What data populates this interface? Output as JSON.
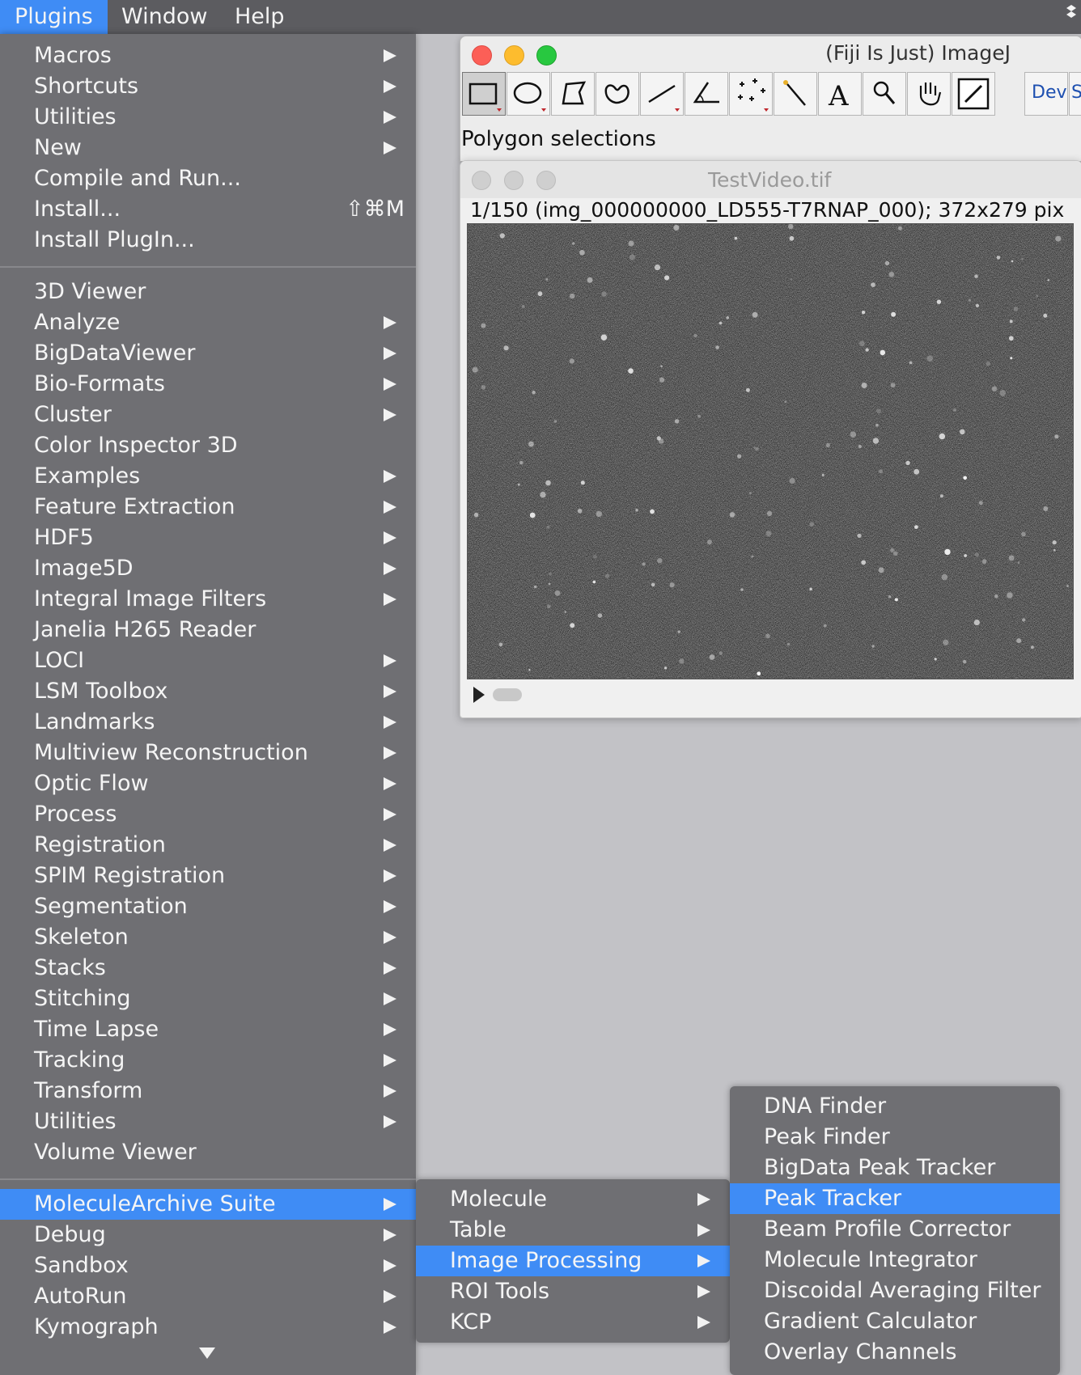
{
  "menubar": {
    "items": [
      "Plugins",
      "Window",
      "Help"
    ]
  },
  "plugins_menu": {
    "group1": [
      {
        "label": "Macros",
        "arrow": true
      },
      {
        "label": "Shortcuts",
        "arrow": true
      },
      {
        "label": "Utilities",
        "arrow": true
      },
      {
        "label": "New",
        "arrow": true
      },
      {
        "label": "Compile and Run...",
        "arrow": false
      },
      {
        "label": "Install...",
        "arrow": false,
        "shortcut": "⇧⌘M"
      },
      {
        "label": "Install PlugIn...",
        "arrow": false
      }
    ],
    "group2": [
      {
        "label": "3D Viewer",
        "arrow": false
      },
      {
        "label": "Analyze",
        "arrow": true
      },
      {
        "label": "BigDataViewer",
        "arrow": true
      },
      {
        "label": "Bio-Formats",
        "arrow": true
      },
      {
        "label": "Cluster",
        "arrow": true
      },
      {
        "label": "Color Inspector 3D",
        "arrow": false
      },
      {
        "label": "Examples",
        "arrow": true
      },
      {
        "label": "Feature Extraction",
        "arrow": true
      },
      {
        "label": "HDF5",
        "arrow": true
      },
      {
        "label": "Image5D",
        "arrow": true
      },
      {
        "label": "Integral Image Filters",
        "arrow": true
      },
      {
        "label": "Janelia H265 Reader",
        "arrow": false
      },
      {
        "label": "LOCI",
        "arrow": true
      },
      {
        "label": "LSM Toolbox",
        "arrow": true
      },
      {
        "label": "Landmarks",
        "arrow": true
      },
      {
        "label": "Multiview Reconstruction",
        "arrow": true
      },
      {
        "label": "Optic Flow",
        "arrow": true
      },
      {
        "label": "Process",
        "arrow": true
      },
      {
        "label": "Registration",
        "arrow": true
      },
      {
        "label": "SPIM Registration",
        "arrow": true
      },
      {
        "label": "Segmentation",
        "arrow": true
      },
      {
        "label": "Skeleton",
        "arrow": true
      },
      {
        "label": "Stacks",
        "arrow": true
      },
      {
        "label": "Stitching",
        "arrow": true
      },
      {
        "label": "Time Lapse",
        "arrow": true
      },
      {
        "label": "Tracking",
        "arrow": true
      },
      {
        "label": "Transform",
        "arrow": true
      },
      {
        "label": "Utilities",
        "arrow": true
      },
      {
        "label": "Volume Viewer",
        "arrow": false
      }
    ],
    "group3": [
      {
        "label": "MoleculeArchive Suite",
        "arrow": true,
        "selected": true
      },
      {
        "label": "Debug",
        "arrow": true
      },
      {
        "label": "Sandbox",
        "arrow": true
      },
      {
        "label": "AutoRun",
        "arrow": true
      },
      {
        "label": "Kymograph",
        "arrow": true
      }
    ]
  },
  "mas_menu": [
    {
      "label": "Molecule",
      "arrow": true
    },
    {
      "label": "Table",
      "arrow": true
    },
    {
      "label": "Image Processing",
      "arrow": true,
      "selected": true
    },
    {
      "label": "ROI Tools",
      "arrow": true
    },
    {
      "label": "KCP",
      "arrow": true
    }
  ],
  "image_processing_menu": [
    {
      "label": "DNA Finder"
    },
    {
      "label": "Peak Finder"
    },
    {
      "label": "BigData Peak Tracker"
    },
    {
      "label": "Peak Tracker",
      "selected": true
    },
    {
      "label": "Beam Profile Corrector"
    },
    {
      "label": "Molecule Integrator"
    },
    {
      "label": "Discoidal Averaging Filter"
    },
    {
      "label": "Gradient Calculator"
    },
    {
      "label": "Overlay Channels"
    }
  ],
  "imagej": {
    "title": "(Fiji Is Just) ImageJ",
    "status": "Polygon selections",
    "tools": [
      "rectangle-tool-icon",
      "oval-tool-icon",
      "polygon-tool-icon",
      "freehand-tool-icon",
      "line-tool-icon",
      "angle-tool-icon",
      "point-tool-icon",
      "wand-tool-icon",
      "text-tool-icon",
      "magnifier-tool-icon",
      "hand-tool-icon",
      "color-picker-tool-icon"
    ],
    "dev_label": "Dev",
    "s_label": "S"
  },
  "testvideo": {
    "title": "TestVideo.tif",
    "info": "1/150 (img_000000000_LD555-T7RNAP_000); 372x279 pix"
  },
  "colors": {
    "menu_bg": "#6f6f73",
    "selection": "#3f8cf5",
    "desktop": "#c2c2c6"
  }
}
